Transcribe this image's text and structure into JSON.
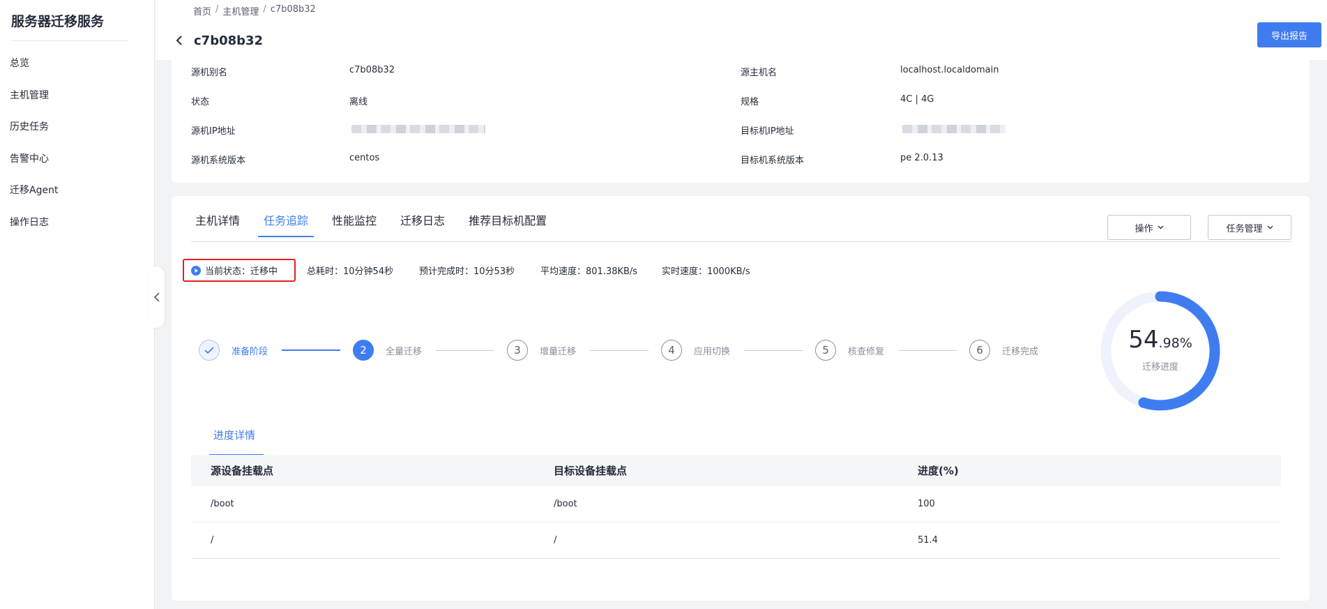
{
  "sidebar": {
    "title": "服务器迁移服务",
    "items": [
      {
        "label": "总览"
      },
      {
        "label": "主机管理"
      },
      {
        "label": "历史任务"
      },
      {
        "label": "告警中心"
      },
      {
        "label": "迁移Agent"
      },
      {
        "label": "操作日志"
      }
    ],
    "collapse_icon": "chevron-left-icon"
  },
  "header": {
    "breadcrumb": [
      "首页",
      "主机管理",
      "c7b08b32"
    ],
    "breadcrumb_separator": "/",
    "title": "c7b08b32",
    "back_icon": "chevron-left-icon",
    "export_label": "导出报告"
  },
  "info": {
    "left": [
      {
        "label": "源机别名",
        "value": "c7b08b32"
      },
      {
        "label": "状态",
        "value": "离线"
      },
      {
        "label": "源机IP地址",
        "value": ""
      },
      {
        "label": "源机系统版本",
        "value": "centos"
      }
    ],
    "right": [
      {
        "label": "源主机名",
        "value": "localhost.localdomain"
      },
      {
        "label": "规格",
        "value": "4C | 4G"
      },
      {
        "label": "目标机IP地址",
        "value": ""
      },
      {
        "label": "目标机系统版本",
        "value": "pe 2.0.13"
      }
    ]
  },
  "tabs": [
    {
      "label": "主机详情"
    },
    {
      "label": "任务追踪"
    },
    {
      "label": "性能监控"
    },
    {
      "label": "迁移日志"
    },
    {
      "label": "推荐目标机配置"
    }
  ],
  "active_tab": "任务追踪",
  "actions": {
    "operate_label": "操作",
    "task_manage_label": "任务管理"
  },
  "status": {
    "current": "当前状态：迁移中",
    "total_time": "总耗时：10分钟54秒",
    "eta": "预计完成时：10分53秒",
    "avg_speed": "平均速度：801.38KB/s",
    "realtime_speed": "实时速度：1000KB/s",
    "icon": "play-circle-icon"
  },
  "steps": [
    {
      "number": "✓",
      "label": "准备阶段",
      "state": "done"
    },
    {
      "number": "2",
      "label": "全量迁移",
      "state": "active"
    },
    {
      "number": "3",
      "label": "增量迁移",
      "state": "pending"
    },
    {
      "number": "4",
      "label": "应用切换",
      "state": "pending"
    },
    {
      "number": "5",
      "label": "核查修复",
      "state": "pending"
    },
    {
      "number": "6",
      "label": "迁移完成",
      "state": "pending"
    }
  ],
  "progress": {
    "integer": "54",
    "decimal": ".98%",
    "value_percent": 54.98,
    "label": "迁移进度",
    "color": "#3f7cf0",
    "track_color": "#eef2fb"
  },
  "details": {
    "tab_label": "进度详情",
    "columns": [
      "源设备挂载点",
      "目标设备挂载点",
      "进度(%)"
    ],
    "rows": [
      [
        "/boot",
        "/boot",
        "100"
      ],
      [
        "/",
        "/",
        "51.4"
      ]
    ]
  },
  "colors": {
    "primary": "#3f7cf0",
    "highlight_border": "#e02020"
  }
}
